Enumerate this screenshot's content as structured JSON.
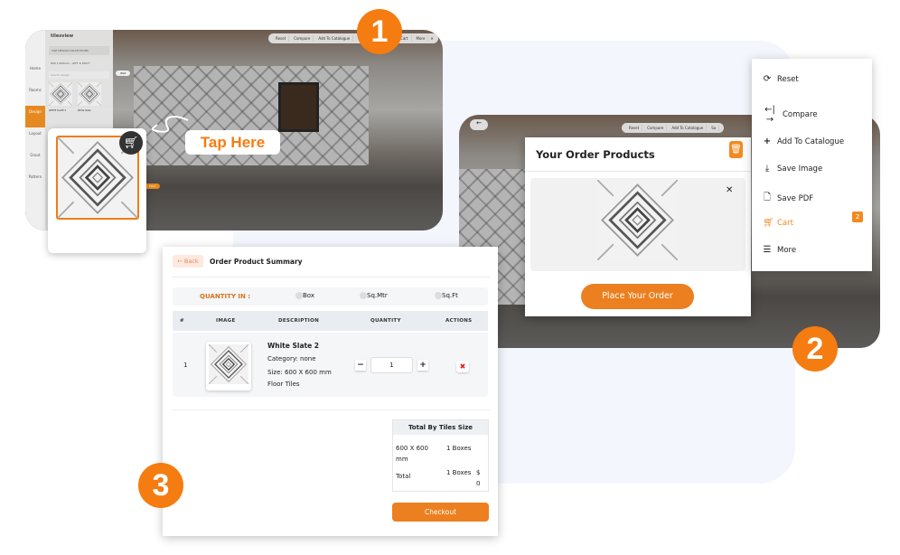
{
  "colors": {
    "accent": "#f57c10",
    "background_panel": "#f3f6fc"
  },
  "step_badges": [
    "1",
    "2",
    "3"
  ],
  "step1": {
    "logo": "tilesview",
    "sidebar_nav": [
      "Home",
      "Rooms",
      "Design",
      "Layout",
      "Grout",
      "Pattern"
    ],
    "sidebar_panel_title": "TILE DESIGN COLLECTIONS",
    "size_select": "600 x 600mm - GIFT & POUT",
    "search_placeholder": "Search design",
    "tile_names": [
      "WHITE SLATE 2",
      "White Slate"
    ],
    "toolbar": [
      "Reset",
      "Compare",
      "Add To Catalogue",
      "Save",
      "Cart",
      "More"
    ],
    "wall_label": "Wall",
    "floor_label": "Floor",
    "tap_here": "Tap Here",
    "cart_icon": "cart-plus-icon"
  },
  "step2": {
    "toolbar": [
      "Reset",
      "Compare",
      "Add To Catalogue",
      "Sa"
    ],
    "modal_title": "Your Order Products",
    "place_order": "Place Your Order",
    "menu": [
      {
        "label": "Reset",
        "icon": "refresh-icon"
      },
      {
        "label": "Compare",
        "icon": "compare-icon"
      },
      {
        "label": "Add To Catalogue",
        "icon": "plus-icon"
      },
      {
        "label": "Save Image",
        "icon": "download-icon"
      },
      {
        "label": "Save PDF",
        "icon": "file-icon"
      },
      {
        "label": "Cart",
        "icon": "cart-icon",
        "badge": "2",
        "active": true
      },
      {
        "label": "More",
        "icon": "list-icon"
      }
    ]
  },
  "step3": {
    "back": "Back",
    "title": "Order Product Summary",
    "quantity_in": "QUANTITY IN :",
    "units": [
      "Box",
      "Sq.Mtr",
      "Sq.Ft"
    ],
    "columns": [
      "#",
      "IMAGE",
      "DESCRIPTION",
      "QUANTITY",
      "ACTIONS"
    ],
    "rows": [
      {
        "index": "1",
        "name": "White Slate 2",
        "category": "Category: none",
        "size": "Size: 600 X 600 mm",
        "type": "Floor Tiles",
        "quantity": "1"
      }
    ],
    "totals": {
      "title": "Total By Tiles Size",
      "rows": [
        [
          "600 X 600 mm",
          "1 Boxes",
          ""
        ],
        [
          "Total",
          "1 Boxes",
          "$ 0"
        ]
      ]
    },
    "checkout": "Checkout"
  }
}
